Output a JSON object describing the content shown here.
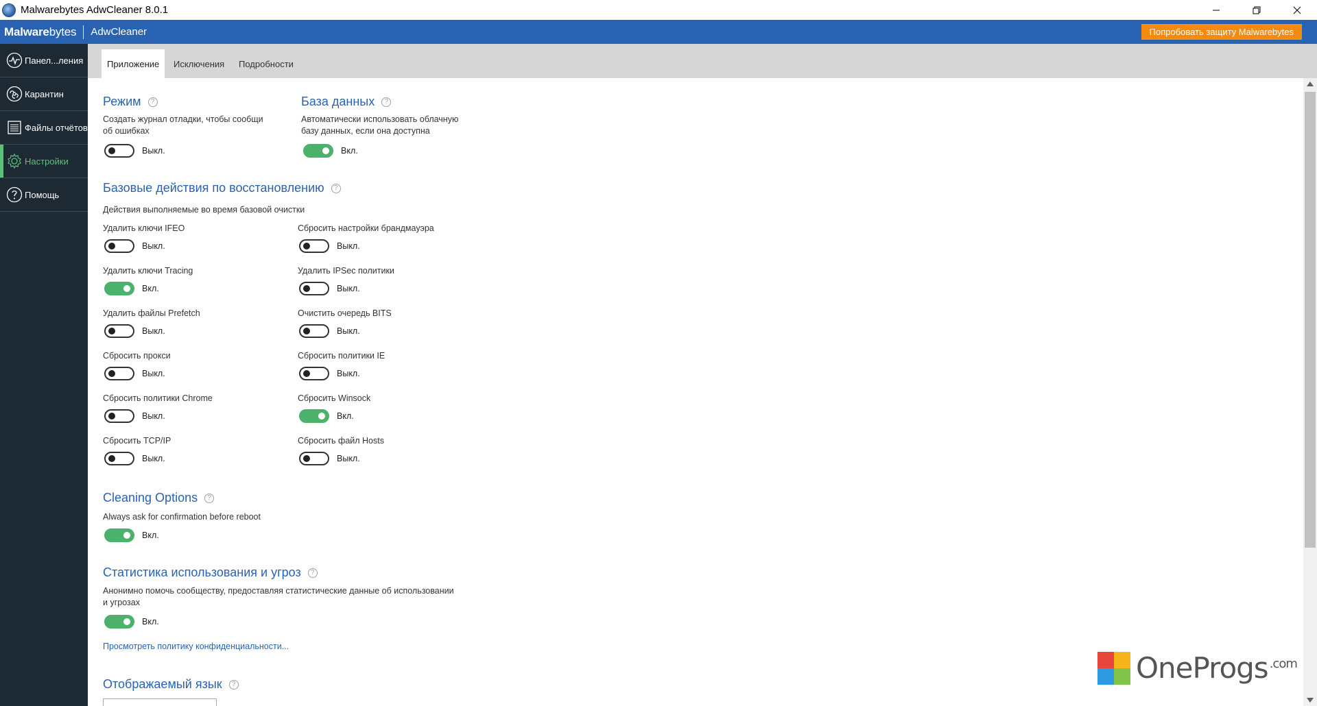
{
  "window": {
    "title": "Malwarebytes AdwCleaner 8.0.1"
  },
  "header": {
    "brand_bold": "Malware",
    "brand_light": "bytes",
    "product": "AdwCleaner",
    "try_button": "Попробовать защиту Malwarebytes"
  },
  "sidebar": {
    "items": [
      {
        "label": "Панел...ления",
        "icon": "dashboard-icon"
      },
      {
        "label": "Карантин",
        "icon": "quarantine-icon"
      },
      {
        "label": "Файлы отчётов",
        "icon": "log-files-icon"
      },
      {
        "label": "Настройки",
        "icon": "settings-icon",
        "active": true
      },
      {
        "label": "Помощь",
        "icon": "help-icon"
      }
    ]
  },
  "tabs": [
    {
      "label": "Приложение",
      "active": true
    },
    {
      "label": "Исключения"
    },
    {
      "label": "Подробности"
    }
  ],
  "mode": {
    "title": "Режим",
    "desc1": "Создать журнал отладки, чтобы сообщи",
    "desc2": "об ошибках",
    "state": "Выкл."
  },
  "database": {
    "title": "База данных",
    "desc1": "Автоматически использовать облачную",
    "desc2": "базу данных, если она доступна",
    "state": "Вкл."
  },
  "recovery": {
    "title": "Базовые действия по восстановлению",
    "desc": "Действия выполняемые во время базовой очистки",
    "left": [
      {
        "label": "Удалить ключи IFEO",
        "state": "Выкл.",
        "on": false
      },
      {
        "label": "Удалить ключи Tracing",
        "state": "Вкл.",
        "on": true
      },
      {
        "label": "Удалить файлы Prefetch",
        "state": "Выкл.",
        "on": false
      },
      {
        "label": "Сбросить прокси",
        "state": "Выкл.",
        "on": false
      },
      {
        "label": "Сбросить политики Chrome",
        "state": "Выкл.",
        "on": false
      },
      {
        "label": "Сбросить TCP/IP",
        "state": "Выкл.",
        "on": false
      }
    ],
    "right": [
      {
        "label": "Сбросить настройки брандмауэра",
        "state": "Выкл.",
        "on": false
      },
      {
        "label": "Удалить IPSec политики",
        "state": "Выкл.",
        "on": false
      },
      {
        "label": "Очистить очередь BITS",
        "state": "Выкл.",
        "on": false
      },
      {
        "label": "Сбросить политики IE",
        "state": "Выкл.",
        "on": false
      },
      {
        "label": "Сбросить Winsock",
        "state": "Вкл.",
        "on": true
      },
      {
        "label": "Сбросить файл Hosts",
        "state": "Выкл.",
        "on": false
      }
    ]
  },
  "cleaning": {
    "title": "Cleaning Options",
    "desc": "Always ask for confirmation before reboot",
    "state": "Вкл."
  },
  "stats": {
    "title": "Статистика использования и угроз",
    "desc1": "Анонимно помочь сообществу, предоставляя статистические данные об использовании",
    "desc2": "и угрозах",
    "state": "Вкл.",
    "privacy_link": "Просмотреть политику конфиденциальности..."
  },
  "language": {
    "title": "Отображаемый язык"
  },
  "watermark": {
    "name": "OneProgs",
    "suffix": ".com"
  },
  "colors": {
    "accent_blue": "#2a62b2",
    "accent_green": "#5ec07a",
    "try_orange": "#f58a0f",
    "sidebar_bg": "#1d2a33"
  }
}
